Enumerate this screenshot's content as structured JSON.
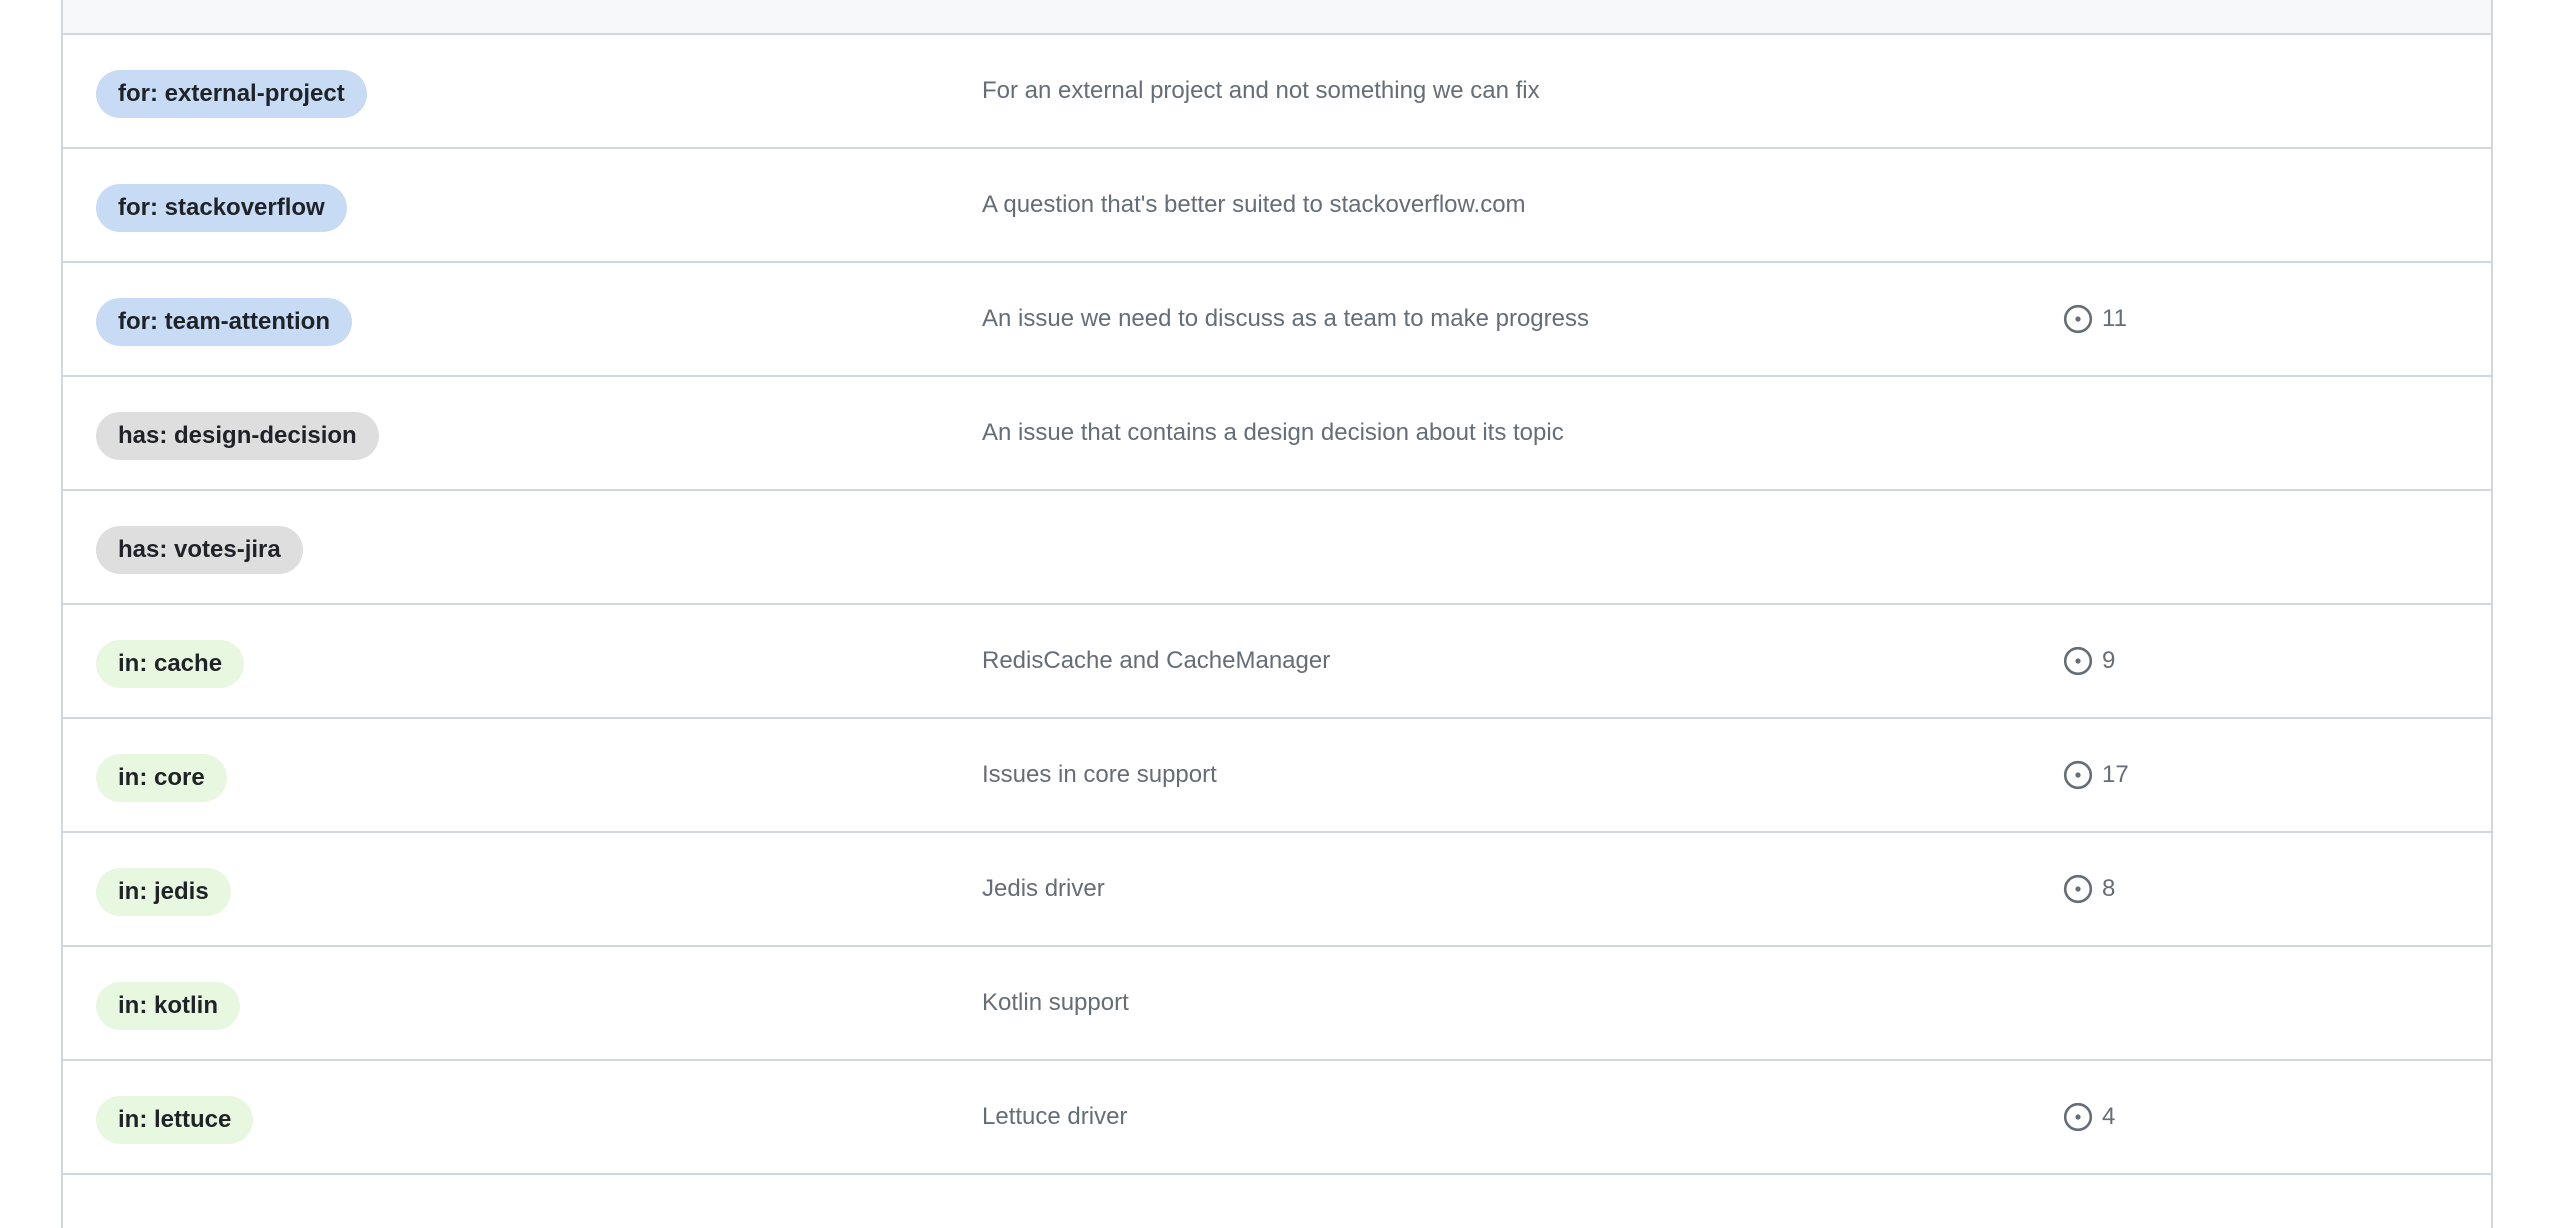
{
  "labels": [
    {
      "name": "for: external-project",
      "description": "For an external project and not something we can fix",
      "issues": "",
      "color": "#c7dbf5"
    },
    {
      "name": "for: stackoverflow",
      "description": "A question that's better suited to stackoverflow.com",
      "issues": "",
      "color": "#c7dbf5"
    },
    {
      "name": "for: team-attention",
      "description": "An issue we need to discuss as a team to make progress",
      "issues": "11",
      "color": "#c7dbf5"
    },
    {
      "name": "has: design-decision",
      "description": "An issue that contains a design decision about its topic",
      "issues": "",
      "color": "#dedede"
    },
    {
      "name": "has: votes-jira",
      "description": "",
      "issues": "",
      "color": "#dedede"
    },
    {
      "name": "in: cache",
      "description": "RedisCache and CacheManager",
      "issues": "9",
      "color": "#e8f7df"
    },
    {
      "name": "in: core",
      "description": "Issues in core support",
      "issues": "17",
      "color": "#e8f7df"
    },
    {
      "name": "in: jedis",
      "description": "Jedis driver",
      "issues": "8",
      "color": "#e8f7df"
    },
    {
      "name": "in: kotlin",
      "description": "Kotlin support",
      "issues": "",
      "color": "#e8f7df"
    },
    {
      "name": "in: lettuce",
      "description": "Lettuce driver",
      "issues": "4",
      "color": "#e8f7df"
    }
  ],
  "icons": {
    "issue_count": "issue-opened-icon"
  }
}
